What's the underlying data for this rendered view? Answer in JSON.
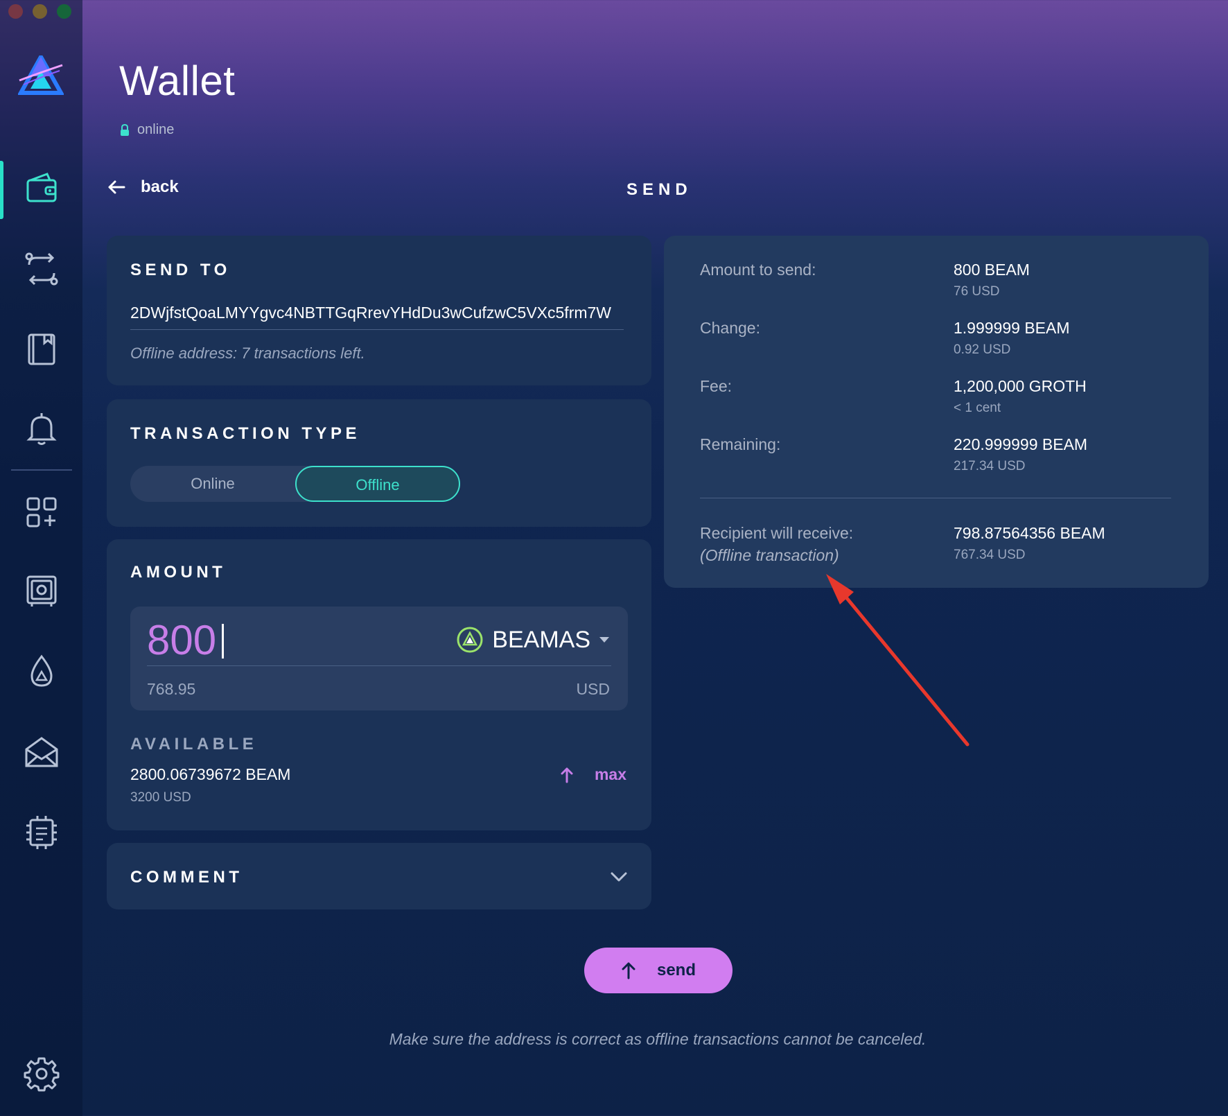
{
  "window": {
    "controls": [
      "close",
      "minimize",
      "zoom"
    ]
  },
  "sidebar": {
    "items": [
      {
        "icon": "wallet-icon",
        "active": true
      },
      {
        "icon": "transactions-icon",
        "active": false
      },
      {
        "icon": "addressbook-icon",
        "active": false
      },
      {
        "icon": "bell-icon",
        "active": false
      },
      {
        "icon": "apps-icon",
        "active": false
      },
      {
        "icon": "vault-icon",
        "active": false
      },
      {
        "icon": "faucet-icon",
        "active": false
      },
      {
        "icon": "mail-icon",
        "active": false
      },
      {
        "icon": "chip-icon",
        "active": false
      },
      {
        "icon": "gear-icon",
        "active": false
      }
    ]
  },
  "header": {
    "title": "Wallet",
    "status": "online"
  },
  "nav": {
    "back_label": "back",
    "page_title": "SEND"
  },
  "send_to": {
    "label": "SEND TO",
    "address": "2DWjfstQoaLMYYgvc4NBTTGqRrevYHdDu3wCufzwC5VXc5frm7W",
    "note": "Offline address: 7 transactions left."
  },
  "transaction_type": {
    "label": "TRANSACTION TYPE",
    "options": [
      "Online",
      "Offline"
    ],
    "selected": "Offline"
  },
  "amount": {
    "label": "AMOUNT",
    "value": "800",
    "currency": "BEAMAS",
    "usd_value": "768.95",
    "usd_label": "USD",
    "available_label": "AVAILABLE",
    "available_value": "2800.06739672 BEAM",
    "available_usd": "3200 USD",
    "max_label": "max"
  },
  "comment": {
    "label": "COMMENT"
  },
  "summary": {
    "rows": [
      {
        "label": "Amount to send:",
        "value": "800 BEAM",
        "sub": "76 USD"
      },
      {
        "label": "Change:",
        "value": "1.999999 BEAM",
        "sub": "0.92 USD"
      },
      {
        "label": "Fee:",
        "value": "1,200,000 GROTH",
        "sub": "< 1 cent"
      },
      {
        "label": "Remaining:",
        "value": "220.999999 BEAM",
        "sub": "217.34 USD"
      }
    ],
    "recipient": {
      "label": "Recipient will receive:",
      "note": "(Offline transaction)",
      "value": "798.87564356 BEAM",
      "sub": "767.34 USD"
    }
  },
  "send_button": {
    "label": "send"
  },
  "footer": {
    "note": "Make sure the address is correct as offline transactions cannot be canceled."
  },
  "colors": {
    "accent_teal": "#3de1cc",
    "accent_purple": "#c77ee8",
    "button_purple": "#d17df0",
    "panel": "#1b3257",
    "annotation_arrow": "#e8382c"
  }
}
